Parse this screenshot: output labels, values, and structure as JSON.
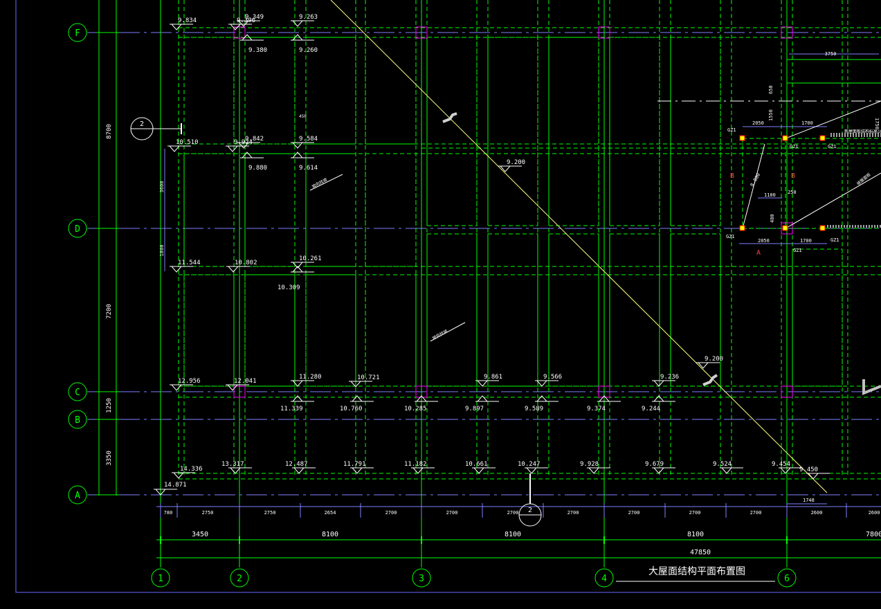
{
  "drawing": {
    "title": "大屋面结构平面布置图",
    "colors": {
      "background": "#000000",
      "axis_green": "#00ff00",
      "beam_dashed": "#00ff00",
      "text_white": "#ffffff",
      "axis_centerline": "#8080ff",
      "frame_blue": "#6a6aff",
      "column_magenta": "#ff00ff",
      "diagonal_yellow": "#ffff80",
      "section_red": "#ff4040"
    },
    "grid_rows": [
      {
        "label": "F"
      },
      {
        "label": "D"
      },
      {
        "label": "C"
      },
      {
        "label": "B"
      },
      {
        "label": "A"
      }
    ],
    "grid_cols": [
      {
        "label": "1"
      },
      {
        "label": "2"
      },
      {
        "label": "3"
      },
      {
        "label": "4"
      },
      {
        "label": "6"
      }
    ],
    "left_dims": [
      "8700",
      "7200",
      "1250",
      "3350"
    ],
    "left_small_dims": [
      "3600",
      "1800"
    ],
    "bottom_small_dims": [
      "780",
      "2750",
      "2750",
      "2654",
      "2700",
      "2700",
      "2700",
      "2700",
      "2700",
      "2700",
      "2700",
      "2600",
      "2600"
    ],
    "bottom_mid_dims": [
      "3450",
      "8100",
      "8100",
      "8100",
      "7800"
    ],
    "bottom_total": "47850",
    "section_marks": [
      "2",
      "2"
    ],
    "elevations": {
      "row_f": [
        "9.834",
        "9.396",
        "9.349",
        "9.263",
        "9.380",
        "9.260"
      ],
      "row_e": [
        "10.510",
        "9.924",
        "9.842",
        "9.584",
        "9.880",
        "9.614"
      ],
      "row_d": [
        "11.544",
        "10.802",
        "10.261",
        "10.309"
      ],
      "row_c_top": [
        "12.956",
        "12.041",
        "11.280",
        "10.721",
        "9.861",
        "9.566",
        "9.236"
      ],
      "row_c_bottom": [
        "11.339",
        "10.760",
        "10.285",
        "9.897",
        "9.589",
        "9.374",
        "9.244"
      ],
      "row_a": [
        "14.336",
        "13.317",
        "12.487",
        "11.791",
        "11.182",
        "10.661",
        "10.247",
        "9.928",
        "9.679",
        "9.524",
        "9.454",
        "9.450"
      ],
      "row_a_corner": "14.871",
      "diagonal": [
        "9.200",
        "9.200"
      ]
    },
    "detail": {
      "column_tag": "GZ1",
      "dims": [
        "3750",
        "650",
        "1550",
        "1750",
        "2050",
        "1700",
        "250",
        "1100",
        "480",
        "2050",
        "1700",
        "1748"
      ],
      "section_b": "B",
      "section_a": "A",
      "slope_label": "8.800",
      "small_note": "450",
      "note_right": "新屋面板结构标高10.100",
      "arrow_note": "坡屋面板",
      "slope_note_1": "坡向找坡",
      "slope_note_2": "坡向找坡"
    }
  }
}
